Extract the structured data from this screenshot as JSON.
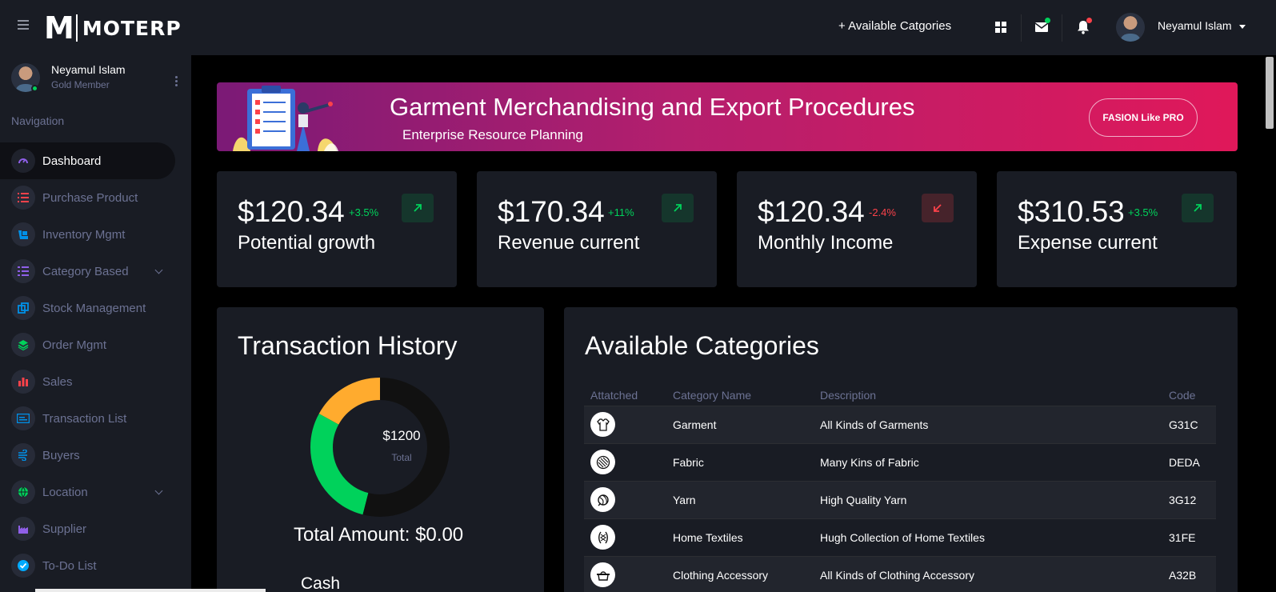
{
  "brand": {
    "mark": "M",
    "name": "MOTERP"
  },
  "topbar": {
    "categories_link": "+ Available Catgories",
    "user_name": "Neyamul Islam"
  },
  "sidebar": {
    "profile": {
      "name": "Neyamul Islam",
      "role": "Gold Member"
    },
    "nav_title": "Navigation",
    "items": [
      {
        "label": "Dashboard",
        "icon": "speedometer-icon",
        "color": "#8f5fe8"
      },
      {
        "label": "Purchase Product",
        "icon": "list-icon",
        "color": "#fc424a"
      },
      {
        "label": "Inventory Mgmt",
        "icon": "inventory-icon",
        "color": "#0090e7"
      },
      {
        "label": "Category Based",
        "icon": "format-list-icon",
        "color": "#8f5fe8"
      },
      {
        "label": "Stock Management",
        "icon": "copy-icon",
        "color": "#0090e7"
      },
      {
        "label": "Order Mgmt",
        "icon": "layers-icon",
        "color": "#00d25b"
      },
      {
        "label": "Sales",
        "icon": "chart-bar-icon",
        "color": "#fc424a"
      },
      {
        "label": "Transaction List",
        "icon": "card-icon",
        "color": "#0090e7"
      },
      {
        "label": "Buyers",
        "icon": "wind-icon",
        "color": "#0090e7"
      },
      {
        "label": "Location",
        "icon": "globe-icon",
        "color": "#00d25b"
      },
      {
        "label": "Supplier",
        "icon": "factory-icon",
        "color": "#8f5fe8"
      },
      {
        "label": "To-Do List",
        "icon": "check-circle-icon",
        "color": "#00aaff"
      }
    ]
  },
  "banner": {
    "title": "Garment Merchandising and Export Procedures",
    "subtitle": "Enterprise Resource Planning",
    "button": "FASION Like PRO"
  },
  "stats": [
    {
      "value": "$120.34",
      "change": "+3.5%",
      "label": "Potential growth",
      "trend": "up"
    },
    {
      "value": "$170.34",
      "change": "+11%",
      "label": "Revenue current",
      "trend": "up"
    },
    {
      "value": "$120.34",
      "change": "-2.4%",
      "label": "Monthly Income",
      "trend": "down"
    },
    {
      "value": "$310.53",
      "change": "+3.5%",
      "label": "Expense current",
      "trend": "up"
    }
  ],
  "colors": {
    "positive": "#00d25b",
    "negative": "#fc424a",
    "donut_orange": "#ffab2e",
    "donut_green": "#00d25b",
    "donut_dark": "#111111"
  },
  "transaction_history": {
    "title": "Transaction History",
    "center_amount": "$1200",
    "center_label": "Total",
    "total_amount": "Total Amount: $0.00",
    "cash_label": "Cash",
    "donut_segments": [
      {
        "color": "orange",
        "fraction": 0.17
      },
      {
        "color": "green",
        "fraction": 0.29
      },
      {
        "color": "dark",
        "fraction": 0.54
      }
    ]
  },
  "categories": {
    "title": "Available Categories",
    "headers": [
      "Attatched",
      "Category Name",
      "Description",
      "Code"
    ],
    "rows": [
      {
        "icon": "garment-icon",
        "name": "Garment",
        "description": "All Kinds of Garments",
        "code": "G31C"
      },
      {
        "icon": "fabric-icon",
        "name": "Fabric",
        "description": "Many Kins of Fabric",
        "code": "DEDA"
      },
      {
        "icon": "yarn-icon",
        "name": "Yarn",
        "description": "High Quality Yarn",
        "code": "3G12"
      },
      {
        "icon": "home-textiles-icon",
        "name": "Home Textiles",
        "description": "Hugh Collection of Home Textiles",
        "code": "31FE"
      },
      {
        "icon": "accessory-icon",
        "name": "Clothing Accessory",
        "description": "All Kinds of Clothing Accessory",
        "code": "A32B"
      }
    ]
  }
}
